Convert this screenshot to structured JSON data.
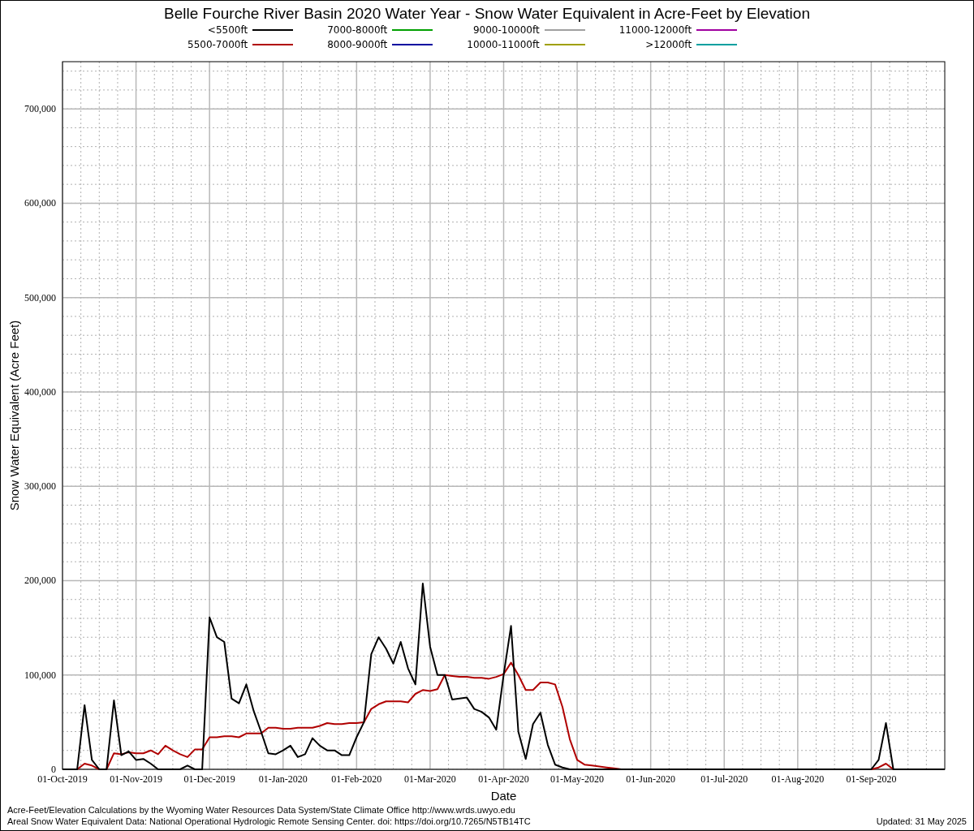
{
  "chart": {
    "chart_data": {
      "type": "line",
      "grid": true,
      "title": "Belle Fourche River Basin 2020 Water Year - Snow Water Equivalent in Acre-Feet by Elevation",
      "xlabel": "Date",
      "ylabel": "Snow Water Equivalent (Acre Feet)",
      "categories": [
        "01-Oct-2019",
        null,
        null,
        null,
        null,
        null,
        null,
        null,
        null,
        null,
        "01-Nov-2019",
        null,
        null,
        null,
        null,
        null,
        null,
        null,
        null,
        null,
        "01-Dec-2019",
        null,
        null,
        null,
        null,
        null,
        null,
        null,
        null,
        null,
        "01-Jan-2020",
        null,
        null,
        null,
        null,
        null,
        null,
        null,
        null,
        null,
        "01-Feb-2020",
        null,
        null,
        null,
        null,
        null,
        null,
        null,
        null,
        null,
        "01-Mar-2020",
        null,
        null,
        null,
        null,
        null,
        null,
        null,
        null,
        null,
        "01-Apr-2020",
        null,
        null,
        null,
        null,
        null,
        null,
        null,
        null,
        null,
        "01-May-2020",
        null,
        null,
        null,
        null,
        null,
        null,
        null,
        null,
        null,
        "01-Jun-2020",
        null,
        null,
        null,
        null,
        null,
        null,
        null,
        null,
        null,
        "01-Jul-2020",
        null,
        null,
        null,
        null,
        null,
        null,
        null,
        null,
        null,
        "01-Aug-2020",
        null,
        null,
        null,
        null,
        null,
        null,
        null,
        null,
        null,
        "01-Sep-2020",
        null,
        null,
        null,
        null,
        null,
        null,
        null,
        null,
        null,
        null
      ],
      "ylim": [
        0,
        750000
      ],
      "yticks": [
        {
          "value": 0,
          "label": "0"
        },
        {
          "value": 100000,
          "label": "100,000"
        },
        {
          "value": 200000,
          "label": "200,000"
        },
        {
          "value": 300000,
          "label": "300,000"
        },
        {
          "value": 400000,
          "label": "400,000"
        },
        {
          "value": 500000,
          "label": "500,000"
        },
        {
          "value": 600000,
          "label": "600,000"
        },
        {
          "value": 700000,
          "label": "700,000"
        }
      ],
      "series": [
        {
          "name": "<5500ft",
          "color": "#000000",
          "values": [
            0,
            0,
            0,
            68000,
            10000,
            0,
            0,
            73000,
            15000,
            19000,
            10000,
            11000,
            6000,
            0,
            0,
            0,
            0,
            4000,
            0,
            0,
            161000,
            140000,
            135000,
            75000,
            70000,
            90000,
            62000,
            40000,
            17000,
            16000,
            20000,
            25000,
            13000,
            16000,
            33000,
            25000,
            20000,
            20000,
            15000,
            15000,
            34000,
            50000,
            122000,
            140000,
            128000,
            112000,
            135000,
            107000,
            90000,
            197000,
            130000,
            100000,
            100000,
            74000,
            75000,
            76000,
            64000,
            61000,
            55000,
            42000,
            100000,
            152000,
            40000,
            11000,
            48000,
            60000,
            26000,
            5000,
            2000,
            0,
            0,
            0,
            0,
            0,
            0,
            0,
            0,
            0,
            0,
            0,
            0,
            0,
            0,
            0,
            0,
            0,
            0,
            0,
            0,
            0,
            0,
            0,
            0,
            0,
            0,
            0,
            0,
            0,
            0,
            0,
            0,
            0,
            0,
            0,
            0,
            0,
            0,
            0,
            0,
            0,
            0,
            10000,
            49000,
            0,
            0,
            0,
            0,
            0,
            0,
            0,
            0
          ]
        },
        {
          "name": "5500-7000ft",
          "color": "#b00000",
          "values": [
            0,
            0,
            0,
            6000,
            4000,
            0,
            0,
            17000,
            16000,
            18000,
            17000,
            17000,
            20000,
            16000,
            25000,
            20000,
            16000,
            13000,
            21000,
            21000,
            34000,
            34000,
            35000,
            35000,
            34000,
            38000,
            38000,
            38000,
            44000,
            44000,
            43000,
            43000,
            44000,
            44000,
            44000,
            46000,
            49000,
            48000,
            48000,
            49000,
            49000,
            50000,
            64000,
            69000,
            72000,
            72000,
            72000,
            71000,
            80000,
            84000,
            83000,
            85000,
            100000,
            99000,
            98000,
            98000,
            97000,
            97000,
            96000,
            98000,
            101000,
            113000,
            100000,
            84000,
            84000,
            92000,
            92000,
            90000,
            66000,
            32000,
            10000,
            5000,
            4000,
            3000,
            2000,
            1000,
            0,
            0,
            0,
            0,
            0,
            0,
            0,
            0,
            0,
            0,
            0,
            0,
            0,
            0,
            0,
            0,
            0,
            0,
            0,
            0,
            0,
            0,
            0,
            0,
            0,
            0,
            0,
            0,
            0,
            0,
            0,
            0,
            0,
            0,
            0,
            2000,
            6000,
            0,
            0,
            null,
            null,
            null,
            null,
            null,
            null
          ]
        },
        {
          "name": "7000-8000ft",
          "color": "#00a000",
          "values": [
            null,
            null,
            null,
            null,
            null,
            null,
            null,
            null,
            null,
            null,
            null,
            null,
            null,
            null,
            null,
            null,
            null,
            null,
            null,
            null,
            null,
            null,
            null,
            null,
            null,
            null,
            null,
            null,
            null,
            null,
            null,
            null,
            null,
            null,
            null,
            null,
            null,
            null,
            null,
            null,
            null,
            null,
            null,
            null,
            null,
            null,
            null,
            null,
            null,
            null,
            null,
            null,
            null,
            null,
            null,
            null,
            null,
            null,
            null,
            null,
            null,
            null,
            null,
            null,
            null,
            null,
            null,
            null,
            null,
            null,
            null,
            null,
            null,
            null,
            null,
            null,
            null,
            null,
            null,
            null,
            null,
            null,
            null,
            null,
            null,
            null,
            null,
            null,
            null,
            null,
            null,
            null,
            null,
            null,
            null,
            null,
            null,
            null,
            null,
            null,
            null,
            null,
            null,
            null,
            null,
            null,
            null,
            null,
            null,
            null,
            null,
            null,
            null,
            null,
            null,
            null,
            null,
            null,
            null,
            null,
            null
          ]
        },
        {
          "name": "8000-9000ft",
          "color": "#0000a0",
          "values": [
            null,
            null,
            null,
            null,
            null,
            null,
            null,
            null,
            null,
            null,
            null,
            null,
            null,
            null,
            null,
            null,
            null,
            null,
            null,
            null,
            null,
            null,
            null,
            null,
            null,
            null,
            null,
            null,
            null,
            null,
            null,
            null,
            null,
            null,
            null,
            null,
            null,
            null,
            null,
            null,
            null,
            null,
            null,
            null,
            null,
            null,
            null,
            null,
            null,
            null,
            null,
            null,
            null,
            null,
            null,
            null,
            null,
            null,
            null,
            null,
            null,
            null,
            null,
            null,
            null,
            null,
            null,
            null,
            null,
            null,
            null,
            null,
            null,
            null,
            null,
            null,
            null,
            null,
            null,
            null,
            null,
            null,
            null,
            null,
            null,
            null,
            null,
            null,
            null,
            null,
            null,
            null,
            null,
            null,
            null,
            null,
            null,
            null,
            null,
            null,
            null,
            null,
            null,
            null,
            null,
            null,
            null,
            null,
            null,
            null,
            null,
            null,
            null,
            null,
            null,
            null,
            null,
            null,
            null,
            null,
            null
          ]
        },
        {
          "name": "9000-10000ft",
          "color": "#a0a0a0",
          "values": [
            null,
            null,
            null,
            null,
            null,
            null,
            null,
            null,
            null,
            null,
            null,
            null,
            null,
            null,
            null,
            null,
            null,
            null,
            null,
            null,
            null,
            null,
            null,
            null,
            null,
            null,
            null,
            null,
            null,
            null,
            null,
            null,
            null,
            null,
            null,
            null,
            null,
            null,
            null,
            null,
            null,
            null,
            null,
            null,
            null,
            null,
            null,
            null,
            null,
            null,
            null,
            null,
            null,
            null,
            null,
            null,
            null,
            null,
            null,
            null,
            null,
            null,
            null,
            null,
            null,
            null,
            null,
            null,
            null,
            null,
            null,
            null,
            null,
            null,
            null,
            null,
            null,
            null,
            null,
            null,
            null,
            null,
            null,
            null,
            null,
            null,
            null,
            null,
            null,
            null,
            null,
            null,
            null,
            null,
            null,
            null,
            null,
            null,
            null,
            null,
            null,
            null,
            null,
            null,
            null,
            null,
            null,
            null,
            null,
            null,
            null,
            null,
            null,
            null,
            null,
            null,
            null,
            null,
            null,
            null,
            null
          ]
        },
        {
          "name": "10000-11000ft",
          "color": "#a0a000",
          "values": [
            null,
            null,
            null,
            null,
            null,
            null,
            null,
            null,
            null,
            null,
            null,
            null,
            null,
            null,
            null,
            null,
            null,
            null,
            null,
            null,
            null,
            null,
            null,
            null,
            null,
            null,
            null,
            null,
            null,
            null,
            null,
            null,
            null,
            null,
            null,
            null,
            null,
            null,
            null,
            null,
            null,
            null,
            null,
            null,
            null,
            null,
            null,
            null,
            null,
            null,
            null,
            null,
            null,
            null,
            null,
            null,
            null,
            null,
            null,
            null,
            null,
            null,
            null,
            null,
            null,
            null,
            null,
            null,
            null,
            null,
            null,
            null,
            null,
            null,
            null,
            null,
            null,
            null,
            null,
            null,
            null,
            null,
            null,
            null,
            null,
            null,
            null,
            null,
            null,
            null,
            null,
            null,
            null,
            null,
            null,
            null,
            null,
            null,
            null,
            null,
            null,
            null,
            null,
            null,
            null,
            null,
            null,
            null,
            null,
            null,
            null,
            null,
            null,
            null,
            null,
            null,
            null,
            null,
            null,
            null,
            null
          ]
        },
        {
          "name": "11000-12000ft",
          "color": "#a000a0",
          "values": [
            null,
            null,
            null,
            null,
            null,
            null,
            null,
            null,
            null,
            null,
            null,
            null,
            null,
            null,
            null,
            null,
            null,
            null,
            null,
            null,
            null,
            null,
            null,
            null,
            null,
            null,
            null,
            null,
            null,
            null,
            null,
            null,
            null,
            null,
            null,
            null,
            null,
            null,
            null,
            null,
            null,
            null,
            null,
            null,
            null,
            null,
            null,
            null,
            null,
            null,
            null,
            null,
            null,
            null,
            null,
            null,
            null,
            null,
            null,
            null,
            null,
            null,
            null,
            null,
            null,
            null,
            null,
            null,
            null,
            null,
            null,
            null,
            null,
            null,
            null,
            null,
            null,
            null,
            null,
            null,
            null,
            null,
            null,
            null,
            null,
            null,
            null,
            null,
            null,
            null,
            null,
            null,
            null,
            null,
            null,
            null,
            null,
            null,
            null,
            null,
            null,
            null,
            null,
            null,
            null,
            null,
            null,
            null,
            null,
            null,
            null,
            null,
            null,
            null,
            null,
            null,
            null,
            null,
            null,
            null,
            null
          ]
        },
        {
          "name": ">12000ft",
          "color": "#00a0a0",
          "values": [
            null,
            null,
            null,
            null,
            null,
            null,
            null,
            null,
            null,
            null,
            null,
            null,
            null,
            null,
            null,
            null,
            null,
            null,
            null,
            null,
            null,
            null,
            null,
            null,
            null,
            null,
            null,
            null,
            null,
            null,
            null,
            null,
            null,
            null,
            null,
            null,
            null,
            null,
            null,
            null,
            null,
            null,
            null,
            null,
            null,
            null,
            null,
            null,
            null,
            null,
            null,
            null,
            null,
            null,
            null,
            null,
            null,
            null,
            null,
            null,
            null,
            null,
            null,
            null,
            null,
            null,
            null,
            null,
            null,
            null,
            null,
            null,
            null,
            null,
            null,
            null,
            null,
            null,
            null,
            null,
            null,
            null,
            null,
            null,
            null,
            null,
            null,
            null,
            null,
            null,
            null,
            null,
            null,
            null,
            null,
            null,
            null,
            null,
            null,
            null,
            null,
            null,
            null,
            null,
            null,
            null,
            null,
            null,
            null,
            null,
            null,
            null,
            null,
            null,
            null,
            null,
            null,
            null,
            null,
            null,
            null
          ]
        }
      ]
    }
  },
  "footer": {
    "credits": [
      "Acre-Feet/Elevation Calculations by the Wyoming Water Resources Data System/State Climate Office http://www.wrds.uwyo.edu",
      "Areal Snow Water Equivalent Data: National Operational Hydrologic Remote Sensing Center. doi: https://doi.org/10.7265/N5TB14TC"
    ],
    "updated": "Updated: 31 May 2025"
  }
}
